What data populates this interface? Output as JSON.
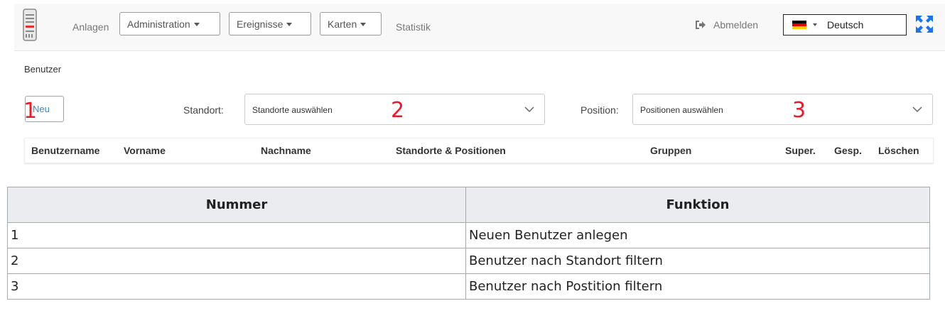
{
  "navbar": {
    "anlagen": "Anlagen",
    "administration": "Administration",
    "ereignisse": "Ereignisse",
    "karten": "Karten",
    "statistik": "Statistik",
    "abmelden": "Abmelden",
    "language": "Deutsch",
    "icons": [
      "server-logo-icon",
      "logout-icon",
      "german-flag-icon",
      "expand-icon"
    ]
  },
  "page": {
    "title": "Benutzer",
    "new_button": "Neu",
    "standort_label": "Standort:",
    "standort_placeholder": "Standorte auswählen",
    "position_label": "Position:",
    "position_placeholder": "Positionen auswählen"
  },
  "annotations": [
    "1",
    "2",
    "3"
  ],
  "table": {
    "columns": [
      "Benutzername",
      "Vorname",
      "Nachname",
      "Standorte & Positionen",
      "Gruppen",
      "Super.",
      "Gesp.",
      "Löschen"
    ]
  },
  "legend": {
    "headers": [
      "Nummer",
      "Funktion"
    ],
    "rows": [
      {
        "nummer": "1",
        "funktion": "Neuen Benutzer anlegen"
      },
      {
        "nummer": "2",
        "funktion": "Benutzer nach Standort filtern"
      },
      {
        "nummer": "3",
        "funktion": "Benutzer nach Postition filtern"
      }
    ]
  },
  "colors": {
    "accent": "#3a86c8",
    "annotation": "#e41c2b",
    "expand_icon": "#1a73e8"
  }
}
